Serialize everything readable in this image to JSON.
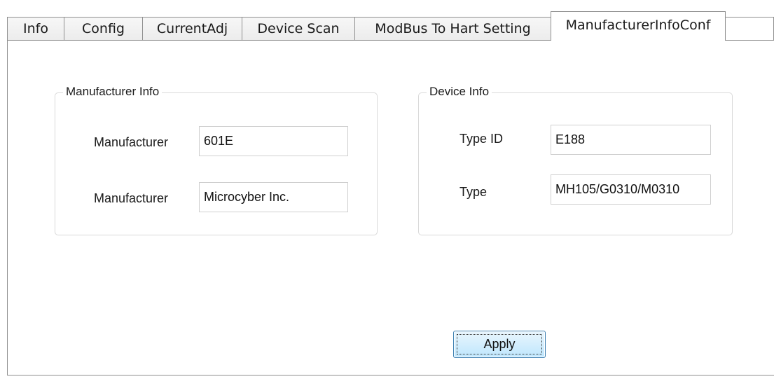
{
  "tabs": [
    {
      "label": "Info"
    },
    {
      "label": "Config"
    },
    {
      "label": "CurrentAdj"
    },
    {
      "label": "Device Scan"
    },
    {
      "label": "ModBus To Hart Setting"
    },
    {
      "label": "ManufacturerInfoConf",
      "active": true
    }
  ],
  "manufacturer_info": {
    "title": "Manufacturer Info",
    "fields": [
      {
        "label": "Manufacturer",
        "value": "601E"
      },
      {
        "label": "Manufacturer",
        "value": "Microcyber Inc."
      }
    ]
  },
  "device_info": {
    "title": "Device Info",
    "fields": [
      {
        "label": "Type ID",
        "value": "E188"
      },
      {
        "label": "Type",
        "value": "MH105/G0310/M0310"
      }
    ]
  },
  "apply_button": {
    "label": "Apply"
  }
}
